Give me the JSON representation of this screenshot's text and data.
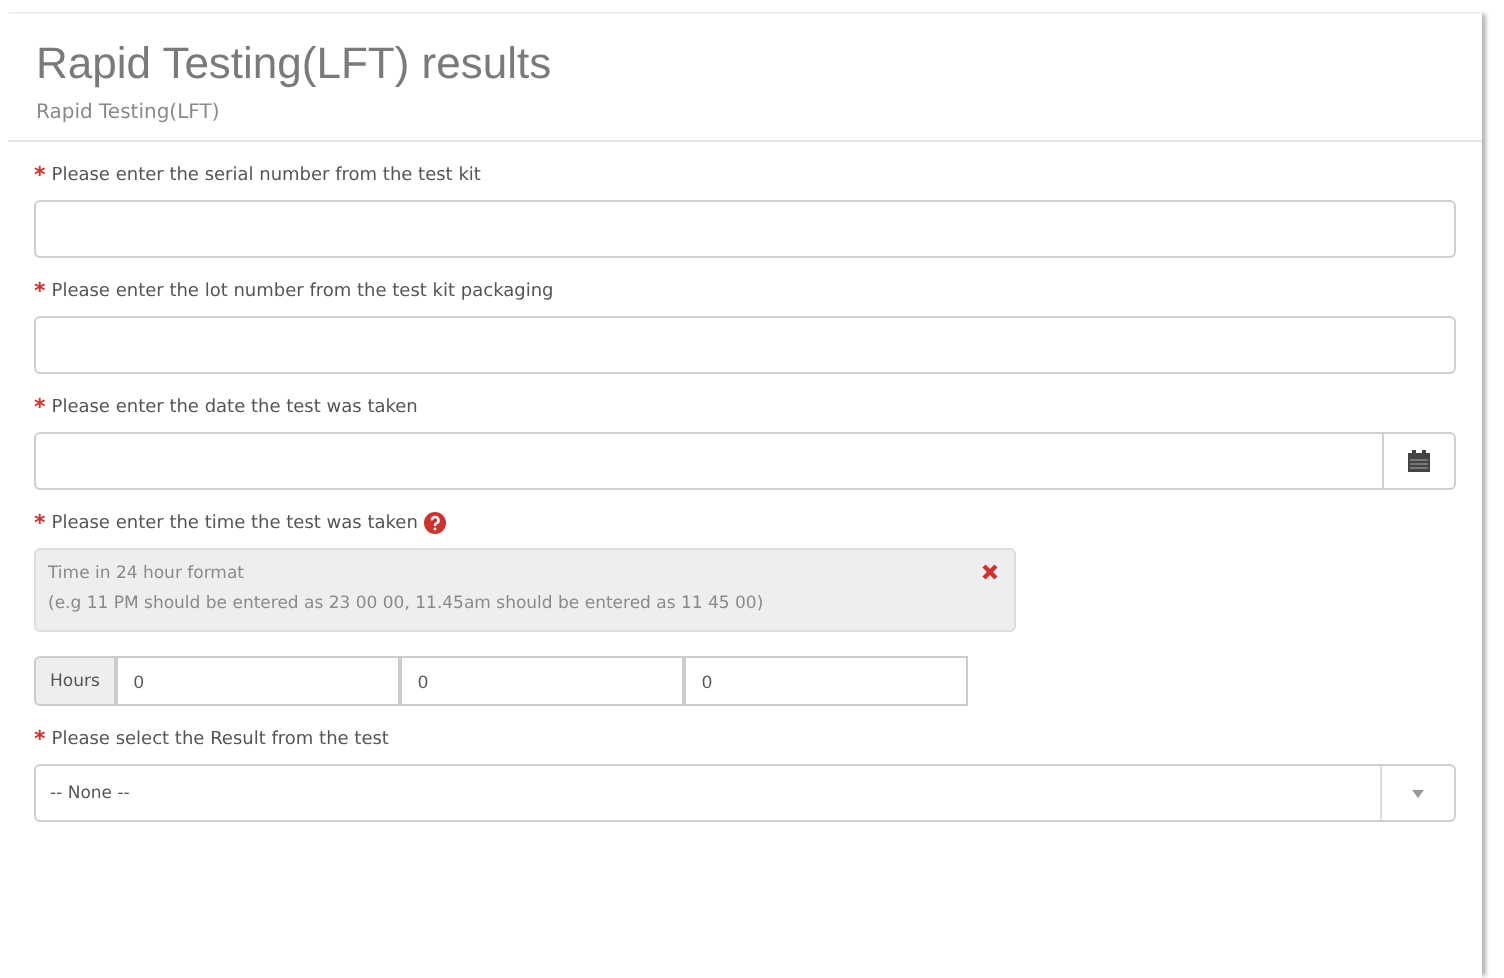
{
  "header": {
    "title": "Rapid Testing(LFT) results",
    "subtitle": "Rapid Testing(LFT)"
  },
  "fields": [
    {
      "kind": "text",
      "marker": "*",
      "label": "Please enter the serial number from the test kit"
    },
    {
      "kind": "text",
      "marker": "*",
      "label": "Please enter the lot number from the test kit packaging"
    },
    {
      "kind": "date",
      "marker": "*",
      "label": "Please enter the date the test was taken"
    },
    {
      "kind": "time",
      "marker": "*",
      "label": "Please enter the time the test was taken",
      "help": {
        "lines": [
          "Time in 24 hour format",
          "(e.g 11 PM should be entered as 23 00 00, 11.45am should be entered as 11 45 00)"
        ]
      },
      "addon": "Hours",
      "values": [
        "0",
        "0",
        "0"
      ]
    },
    {
      "kind": "select",
      "marker": "*",
      "label": "Please select the Result from the test",
      "value": "-- None --"
    }
  ]
}
